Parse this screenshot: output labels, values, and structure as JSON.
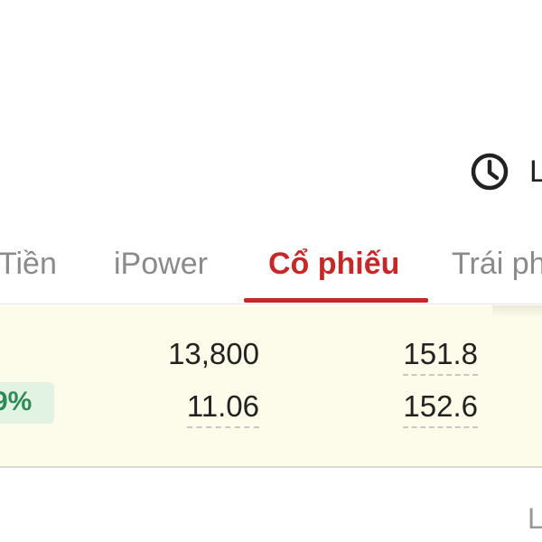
{
  "history": {
    "icon": "clock-icon",
    "label": "L"
  },
  "tabs": [
    {
      "label": "Tiền",
      "active": false
    },
    {
      "label": "iPower",
      "active": false
    },
    {
      "label": "Cổ phiếu",
      "active": true
    },
    {
      "label": "Trái ph",
      "active": false
    }
  ],
  "stock": {
    "change_percent": "9%",
    "row1": {
      "col1": "13,800",
      "col2": "151.8"
    },
    "row2": {
      "col1": "11.06",
      "col2": "152.6"
    }
  },
  "bottom_text": "L",
  "colors": {
    "accent": "#c62828",
    "positive": "#2e8b57",
    "panel_bg": "#fdfbe9",
    "badge_bg": "#e3f3e3"
  }
}
